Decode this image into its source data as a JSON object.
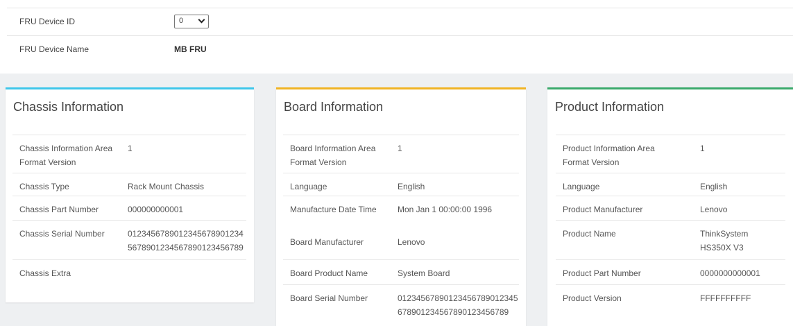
{
  "fru": {
    "device_id_label": "FRU Device ID",
    "device_id_value": "0",
    "device_name_label": "FRU Device Name",
    "device_name_value": "MB FRU"
  },
  "chassis": {
    "title": "Chassis Information",
    "accent": "#3ec6ea",
    "rows": [
      {
        "label": "Chassis Information Area Format Version",
        "value": "1"
      },
      {
        "label": "Chassis Type",
        "value": "Rack Mount Chassis"
      },
      {
        "label": "Chassis Part Number",
        "value": "000000000001"
      },
      {
        "label": "Chassis Serial Number",
        "value": "01234567890123456789012345678901234567890123456789"
      },
      {
        "label": "Chassis Extra",
        "value": ""
      }
    ]
  },
  "board": {
    "title": "Board Information",
    "accent": "#f0b323",
    "rows": [
      {
        "label": "Board Information Area Format Version",
        "value": "1"
      },
      {
        "label": "Language",
        "value": "English"
      },
      {
        "label": "Manufacture Date Time",
        "value": "Mon Jan 1 00:00:00 1996"
      },
      {
        "label": "Board Manufacturer",
        "value": "Lenovo"
      },
      {
        "label": "Board Product Name",
        "value": "System Board"
      },
      {
        "label": "Board Serial Number",
        "value": "01234567890123456789012345678901234567890123456789"
      }
    ]
  },
  "product": {
    "title": "Product Information",
    "accent": "#3aa96b",
    "rows": [
      {
        "label": "Product Information Area Format Version",
        "value": "1"
      },
      {
        "label": "Language",
        "value": "English"
      },
      {
        "label": "Product Manufacturer",
        "value": "Lenovo"
      },
      {
        "label": "Product Name",
        "value": "ThinkSystem HS350X V3"
      },
      {
        "label": "Product Part Number",
        "value": "0000000000001"
      },
      {
        "label": "Product Version",
        "value": "FFFFFFFFFF"
      }
    ]
  }
}
